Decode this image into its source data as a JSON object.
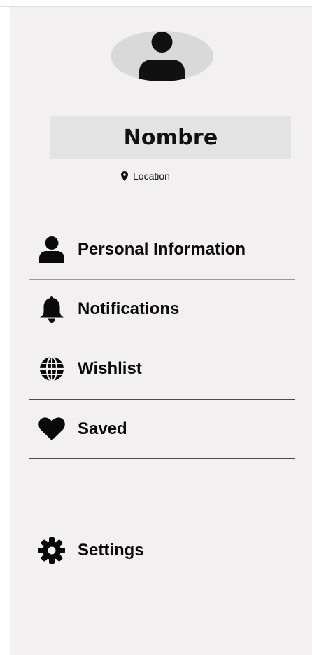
{
  "profile": {
    "name": "Nombre",
    "location": "Location",
    "avatar_icon": "user-silhouette-icon"
  },
  "menu": {
    "items": [
      {
        "label": "Personal Information",
        "icon": "user-icon"
      },
      {
        "label": "Notifications",
        "icon": "bell-icon"
      },
      {
        "label": "Wishlist",
        "icon": "globe-icon"
      },
      {
        "label": "Saved",
        "icon": "heart-icon"
      }
    ]
  },
  "settings": {
    "label": "Settings",
    "icon": "gear-icon"
  },
  "colors": {
    "background": "#f2f0f1",
    "name_box": "#e3e3e3",
    "avatar_bg": "#d9d9d9",
    "text": "#0a0a0a"
  }
}
